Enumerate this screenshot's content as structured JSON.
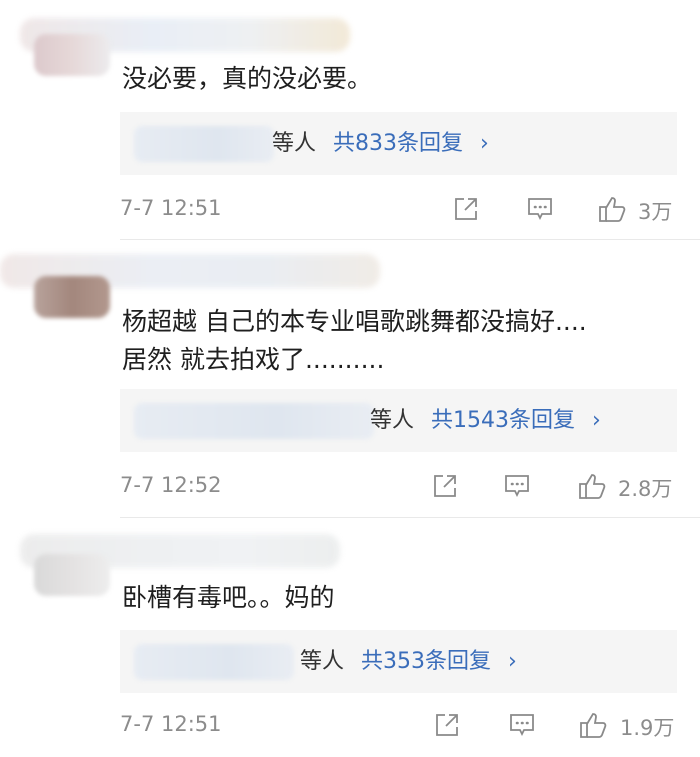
{
  "comments": [
    {
      "text": "没必要，真的没必要。",
      "reply_suffix": "等人",
      "reply_total": "共833条回复",
      "reply_chevron": "›",
      "time": "7-7 12:51",
      "likes": "3万"
    },
    {
      "text": "杨超越 自己的本专业唱歌跳舞都没搞好....\n居然 就去拍戏了..........",
      "reply_suffix": "等人",
      "reply_total": "共1543条回复",
      "reply_chevron": "›",
      "time": "7-7 12:52",
      "likes": "2.8万"
    },
    {
      "text": "卧槽有毒吧。。妈的",
      "reply_suffix": "等人",
      "reply_total": "共353条回复",
      "reply_chevron": "›",
      "time": "7-7 12:51",
      "likes": "1.9万"
    }
  ],
  "icons": {
    "share": "share-icon",
    "comment": "comment-icon",
    "like": "thumbs-up-icon"
  },
  "colors": {
    "link_blue": "#3a6dba",
    "meta_gray": "#8c8c8c",
    "reply_bg": "#f5f5f5"
  }
}
